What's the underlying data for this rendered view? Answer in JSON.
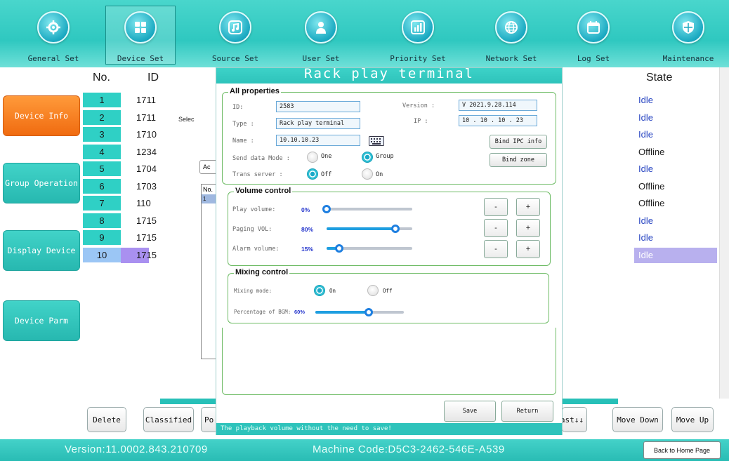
{
  "nav": {
    "items": [
      {
        "label": "General Set"
      },
      {
        "label": "Device Set"
      },
      {
        "label": "Source Set"
      },
      {
        "label": "User Set"
      },
      {
        "label": "Priority Set"
      },
      {
        "label": "Network Set"
      },
      {
        "label": "Log Set"
      },
      {
        "label": "Maintenance"
      }
    ]
  },
  "sidebar": {
    "items": [
      {
        "label": "Device Info"
      },
      {
        "label": "Group Operation"
      },
      {
        "label": "Display Device"
      },
      {
        "label": "Device Parm"
      }
    ]
  },
  "table": {
    "headers": {
      "no": "No.",
      "id": "ID",
      "state": "State"
    },
    "rows": [
      {
        "no": "1",
        "id": "1711",
        "state": "Idle"
      },
      {
        "no": "2",
        "id": "1711",
        "state": "Idle"
      },
      {
        "no": "3",
        "id": "1710",
        "state": "Idle"
      },
      {
        "no": "4",
        "id": "1234",
        "state": "Offline"
      },
      {
        "no": "5",
        "id": "1704",
        "state": "Idle"
      },
      {
        "no": "6",
        "id": "1703",
        "state": "Offline"
      },
      {
        "no": "7",
        "id": "110",
        "state": "Offline"
      },
      {
        "no": "8",
        "id": "1715",
        "state": "Idle"
      },
      {
        "no": "9",
        "id": "1715",
        "state": "Idle"
      },
      {
        "no": "10",
        "id": "1715",
        "state": "Idle"
      }
    ]
  },
  "behind": {
    "select_label": "Selec",
    "add_label": "Ac",
    "no_label": "No.",
    "one_label": "1"
  },
  "bottom": {
    "delete": "Delete",
    "classified": "Classified",
    "po": "Po",
    "last": "ast↓↓",
    "move_down": "Move Down",
    "move_up": "Move Up"
  },
  "footer": {
    "version": "Version:11.0002.843.210709",
    "machine_code": "Machine Code:D5C3-2462-546E-A539",
    "back_home": "Back to Home Page"
  },
  "modal": {
    "title": "Rack play terminal",
    "all_properties": {
      "legend": "All properties",
      "id_label": "ID:",
      "id_value": "2583",
      "version_label": "Version  :",
      "version_value": "V 2021.9.28.114",
      "type_label": "Type :",
      "type_value": "Rack play terminal",
      "ip_label": "IP   :",
      "ip_value": "10 . 10 . 10 . 23",
      "name_label": "Name :",
      "name_value": "10.10.10.23",
      "bind_ipc": "Bind IPC info",
      "bind_zone": "Bind zone",
      "send_mode_label": "Send data Mode :",
      "send_one": "One",
      "send_group": "Group",
      "trans_label": "Trans server  :",
      "trans_off": "Off",
      "trans_on": "On"
    },
    "volume": {
      "legend": "Volume control",
      "play_label": "Play volume:",
      "play_value": "0%",
      "play_level": 0,
      "paging_label": "Paging VOL:",
      "paging_value": "80%",
      "paging_level": 80,
      "alarm_label": "Alarm volume:",
      "alarm_value": "15%",
      "alarm_level": 15,
      "minus": "-",
      "plus": "+"
    },
    "mixing": {
      "legend": "Mixing control",
      "mode_label": "Mixing mode:",
      "on": "On",
      "off": "Off",
      "bgm_label": "Percentage of BGM:",
      "bgm_value": "60%",
      "bgm_level": 60
    },
    "save": "Save",
    "return": "Return",
    "hint": "The playback volume without the need to save!"
  }
}
